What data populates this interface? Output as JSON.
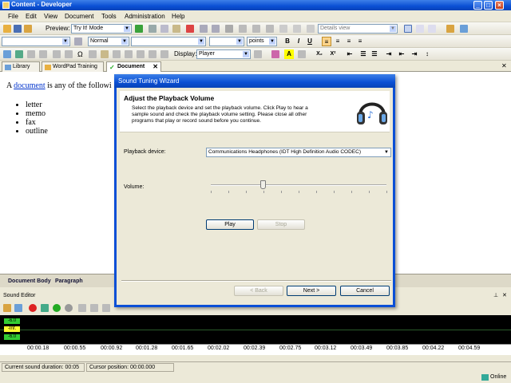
{
  "window": {
    "title": "Content - Developer"
  },
  "menu": [
    "File",
    "Edit",
    "View",
    "Document",
    "Tools",
    "Administration",
    "Help"
  ],
  "toolbar1": {
    "preview_label": "Preview:",
    "preview_value": "Try It! Mode",
    "view_value": "Details view"
  },
  "toolbar2": {
    "style_value": "Normal",
    "size_unit": "points",
    "bold": "B",
    "italic": "I",
    "underline": "U"
  },
  "toolbar3": {
    "display_label": "Display:",
    "display_value": "Player",
    "sub": "X₂",
    "sup": "X²"
  },
  "tabs": [
    {
      "label": "Library"
    },
    {
      "label": "WordPad Training"
    },
    {
      "label": "Document"
    }
  ],
  "document": {
    "intro_prefix": "A ",
    "intro_link": "document",
    "intro_suffix": " is any of the followi",
    "items": [
      "letter",
      "memo",
      "fax",
      "outline"
    ]
  },
  "doc_status": {
    "body": "Document Body",
    "paragraph": "Paragraph"
  },
  "sound_editor": {
    "title": "Sound Editor",
    "levels": [
      "-6.0",
      "-Inf.",
      "-6.0"
    ],
    "timeline": [
      "00:00.18",
      "00:00.55",
      "00:00.92",
      "00:01.28",
      "00:01.65",
      "00:02.02",
      "00:02.39",
      "00:02.75",
      "00:03.12",
      "00:03.49",
      "00:03.85",
      "00:04.22",
      "00:04.59"
    ]
  },
  "status": {
    "duration": "Current sound duration: 00:05",
    "cursor": "Cursor position: 00:00.000",
    "online": "Online"
  },
  "dialog": {
    "title": "Sound Tuning Wizard",
    "heading": "Adjust the Playback Volume",
    "description": "Select the playback device and set the playback volume. Click Play to hear a sample sound and check the playback volume setting. Please close all other programs that play or record sound before you continue.",
    "device_label": "Playback device:",
    "device_value": "Communications Headphones (IDT High Definition Audio CODEC)",
    "volume_label": "Volume:",
    "volume_level": 0.3,
    "play": "Play",
    "stop": "Stop",
    "back": "< Back",
    "next": "Next >",
    "cancel": "Cancel"
  },
  "colors": {
    "accent": "#0a4fd4",
    "highlight": "#fbd38a",
    "level_green": "#33cc33"
  }
}
